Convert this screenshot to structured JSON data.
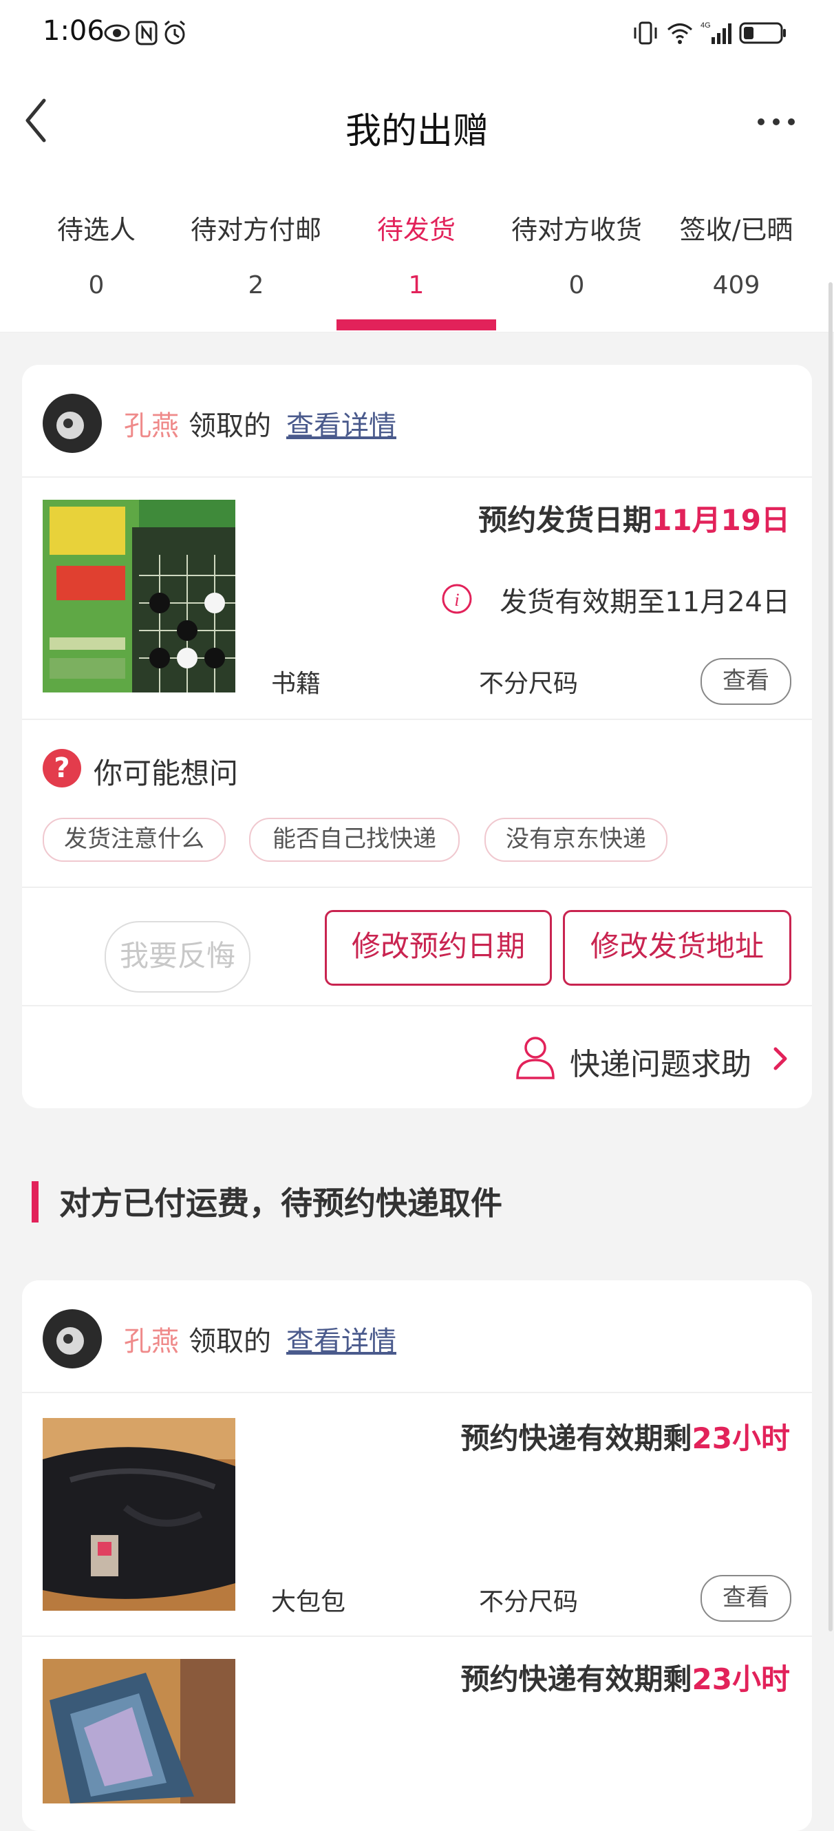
{
  "status_bar": {
    "time": "1:06"
  },
  "header": {
    "title": "我的出赠"
  },
  "tabs": [
    {
      "label": "待选人",
      "count": "0"
    },
    {
      "label": "待对方付邮",
      "count": "2"
    },
    {
      "label": "待发货",
      "count": "1"
    },
    {
      "label": "待对方收货",
      "count": "0"
    },
    {
      "label": "签收/已晒",
      "count": "409"
    }
  ],
  "active_tab": 2,
  "card1": {
    "nickname": "孔燕",
    "claimed_text": "领取的",
    "detail_link": "查看详情",
    "item": {
      "headline_prefix": "预约发货日期",
      "headline_highlight": "11月19日",
      "validity": "发货有效期至11月24日",
      "category": "书籍",
      "size": "不分尺码",
      "view_label": "查看"
    },
    "faq": {
      "title": "你可能想问",
      "chips": [
        "发货注意什么",
        "能否自己找快递",
        "没有京东快递"
      ]
    },
    "actions": {
      "regret": "我要反悔",
      "change_date": "修改预约日期",
      "change_address": "修改发货地址"
    },
    "help": "快递问题求助"
  },
  "section": {
    "title": "对方已付运费，待预约快递取件"
  },
  "card2": {
    "nickname": "孔燕",
    "claimed_text": "领取的",
    "detail_link": "查看详情",
    "items": [
      {
        "headline_prefix": "预约快递有效期剩",
        "headline_highlight": "23小时",
        "category": "大包包",
        "size": "不分尺码",
        "view_label": "查看"
      },
      {
        "headline_prefix": "预约快递有效期剩",
        "headline_highlight": "23小时"
      }
    ]
  },
  "colors": {
    "accent": "#e2225a",
    "nickname": "#ef8a8a",
    "link": "#4a5a8c"
  },
  "icons": [
    "eye-icon",
    "nfc-icon",
    "alarm-icon",
    "vibrate-icon",
    "wifi-icon",
    "signal-icon",
    "battery-icon",
    "back-icon",
    "more-icon",
    "info-icon",
    "question-icon",
    "person-icon",
    "chevron-right-icon"
  ]
}
